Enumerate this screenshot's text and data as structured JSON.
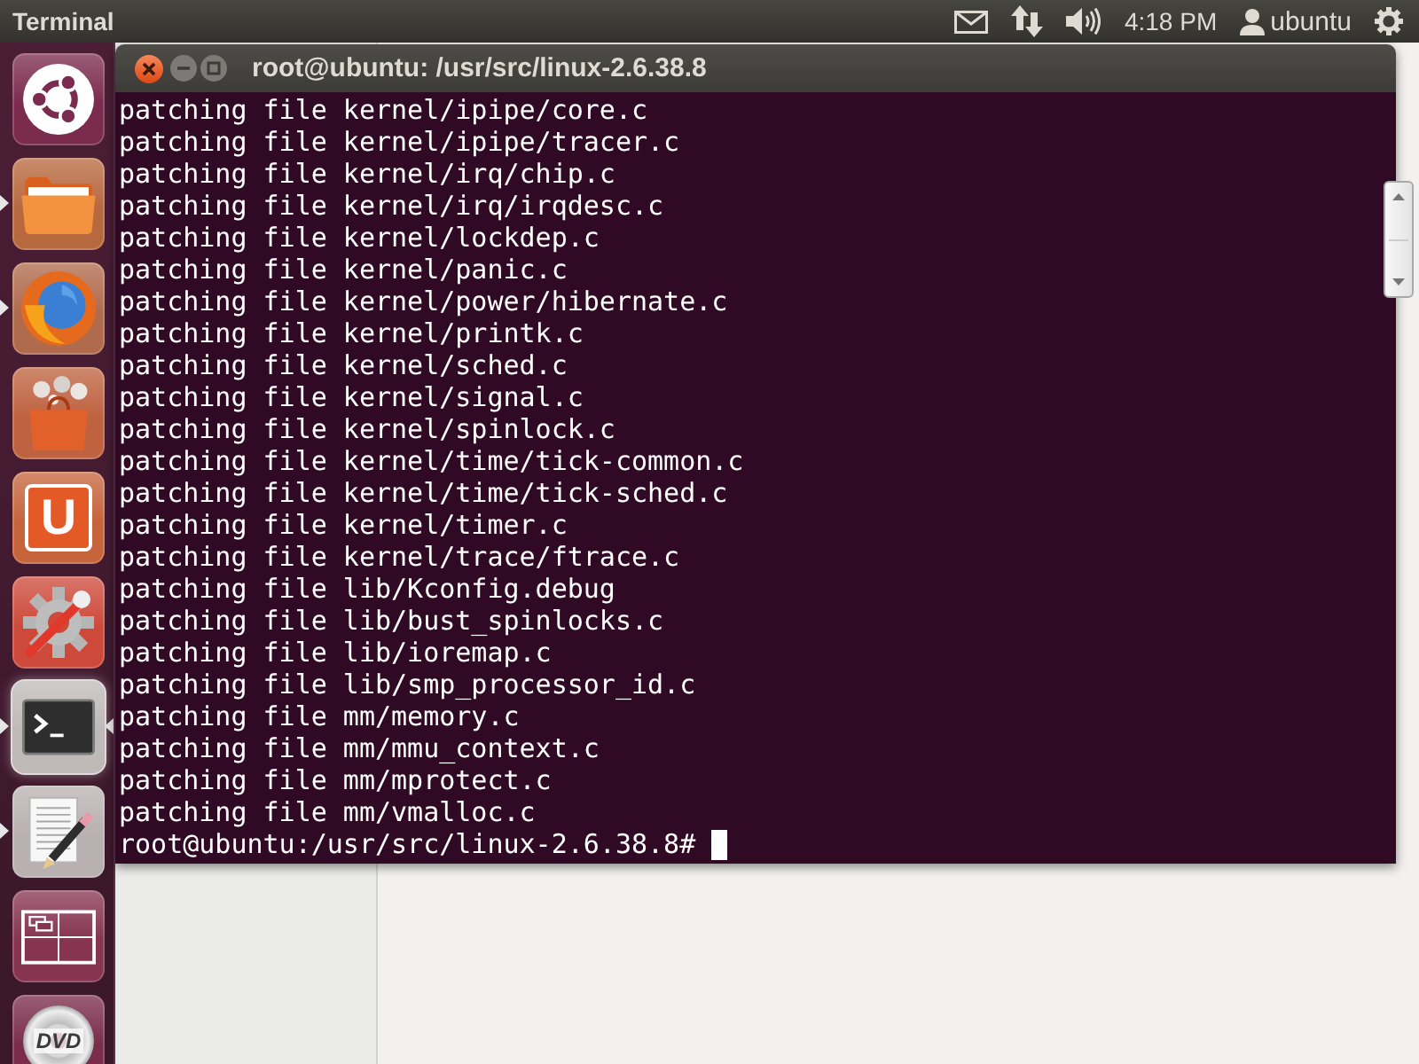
{
  "top_panel": {
    "app_title": "Terminal",
    "clock": "4:18 PM",
    "user": "ubuntu"
  },
  "launcher": {
    "items": [
      {
        "kind": "dash",
        "running": false,
        "selected": false
      },
      {
        "kind": "files",
        "running": true,
        "selected": false
      },
      {
        "kind": "browser",
        "running": true,
        "selected": false
      },
      {
        "kind": "software",
        "running": false,
        "selected": false
      },
      {
        "kind": "cloud",
        "running": false,
        "selected": false,
        "logo_text": "U"
      },
      {
        "kind": "settings",
        "running": false,
        "selected": false
      },
      {
        "kind": "terminal",
        "running": true,
        "selected": true
      },
      {
        "kind": "editor",
        "running": true,
        "selected": false
      },
      {
        "kind": "workspaces",
        "running": false,
        "selected": false
      },
      {
        "kind": "dvd",
        "running": false,
        "selected": false,
        "logo_text": "DVD"
      }
    ]
  },
  "terminal": {
    "title": "root@ubuntu: /usr/src/linux-2.6.38.8",
    "lines": [
      "patching file kernel/ipipe/core.c",
      "patching file kernel/ipipe/tracer.c",
      "patching file kernel/irq/chip.c",
      "patching file kernel/irq/irqdesc.c",
      "patching file kernel/lockdep.c",
      "patching file kernel/panic.c",
      "patching file kernel/power/hibernate.c",
      "patching file kernel/printk.c",
      "patching file kernel/sched.c",
      "patching file kernel/signal.c",
      "patching file kernel/spinlock.c",
      "patching file kernel/time/tick-common.c",
      "patching file kernel/time/tick-sched.c",
      "patching file kernel/timer.c",
      "patching file kernel/trace/ftrace.c",
      "patching file lib/Kconfig.debug",
      "patching file lib/bust_spinlocks.c",
      "patching file lib/ioremap.c",
      "patching file lib/smp_processor_id.c",
      "patching file mm/memory.c",
      "patching file mm/mmu_context.c",
      "patching file mm/mprotect.c",
      "patching file mm/vmalloc.c"
    ],
    "prompt": "root@ubuntu:/usr/src/linux-2.6.38.8#"
  }
}
